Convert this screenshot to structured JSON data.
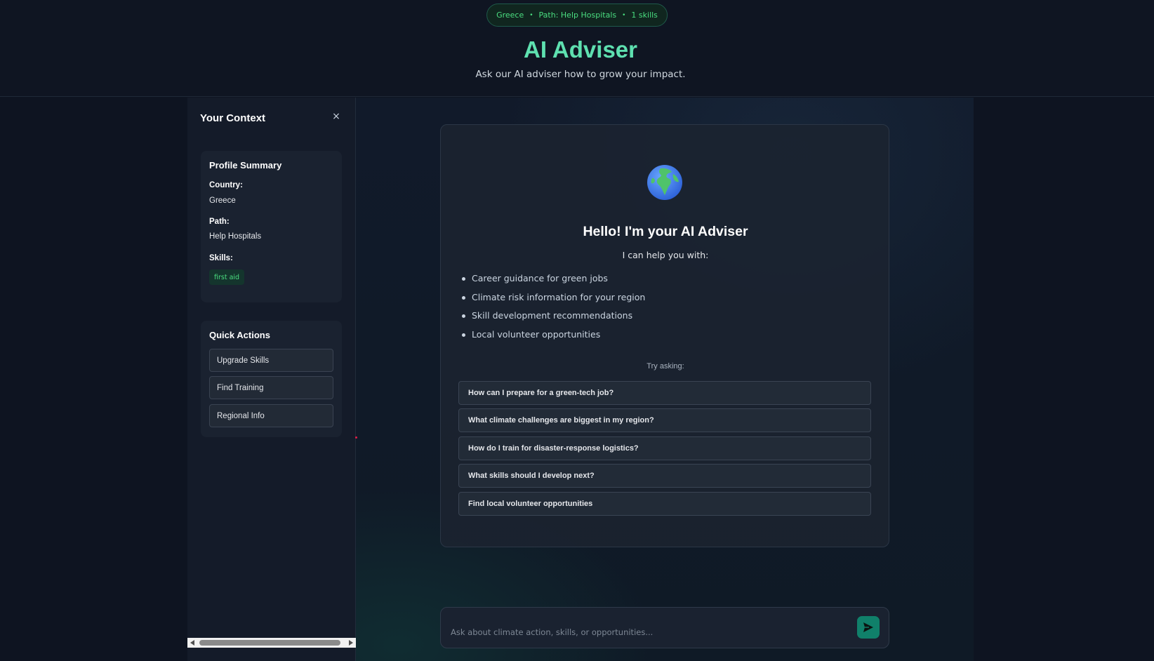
{
  "header": {
    "context_pill": {
      "country": "Greece",
      "path": "Path: Help Hospitals",
      "skills": "1 skills"
    },
    "title": "AI Adviser",
    "subtitle": "Ask our AI adviser how to grow your impact."
  },
  "sidebar": {
    "title": "Your Context",
    "close_icon": "×",
    "profile": {
      "title": "Profile Summary",
      "country_label": "Country:",
      "country_value": "Greece",
      "path_label": "Path:",
      "path_value": "Help Hospitals",
      "skills_label": "Skills:",
      "skills": [
        "first aid"
      ]
    },
    "quick_actions": {
      "title": "Quick Actions",
      "items": [
        "Upgrade Skills",
        "Find Training",
        "Regional Info"
      ]
    }
  },
  "welcome": {
    "icon": "globe-icon",
    "title": "Hello! I'm your AI Adviser",
    "lead": "I can help you with:",
    "help_items": [
      "Career guidance for green jobs",
      "Climate risk information for your region",
      "Skill development recommendations",
      "Local volunteer opportunities"
    ],
    "try_label": "Try asking:",
    "suggestions": [
      "How can I prepare for a green-tech job?",
      "What climate challenges are biggest in my region?",
      "How do I train for disaster-response logistics?",
      "What skills should I develop next?",
      "Find local volunteer opportunities"
    ]
  },
  "input": {
    "value": "",
    "placeholder": "Ask about climate action, skills, or opportunities...",
    "send_icon": "send-icon"
  },
  "colors": {
    "accent": "#5ee0b0",
    "pill_text": "#4ade80",
    "send_button": "#10806a",
    "background": "#0e1421"
  }
}
